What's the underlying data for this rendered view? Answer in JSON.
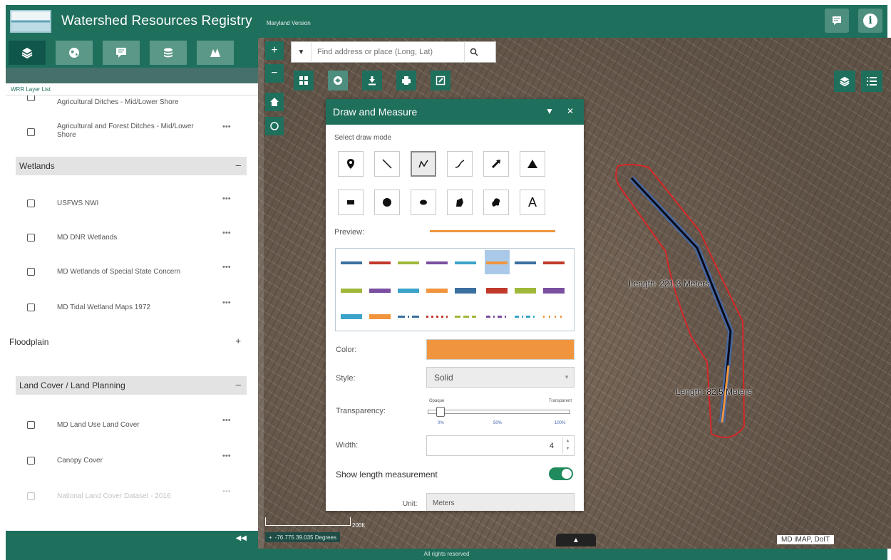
{
  "header": {
    "title": "Watershed Resources Registry",
    "subtitle": "Maryland Version",
    "icons": [
      "message-icon",
      "info-icon"
    ]
  },
  "left_panel": {
    "toolbar_icons": [
      "layers-icon",
      "globe-icon",
      "chat-icon",
      "stack-icon",
      "map-icon"
    ],
    "tab_label": "WRR Layer List",
    "items": [
      {
        "type": "layer",
        "label": "Agricultural Ditches - Mid/Lower Shore"
      },
      {
        "type": "layer",
        "label": "Agricultural and Forest Ditches - Mid/Lower Shore"
      },
      {
        "type": "group",
        "label": "Wetlands",
        "toggle": "–"
      },
      {
        "type": "layer",
        "label": "USFWS NWI"
      },
      {
        "type": "layer",
        "label": "MD DNR Wetlands"
      },
      {
        "type": "layer",
        "label": "MD Wetlands of Special State Concern"
      },
      {
        "type": "layer",
        "label": "MD Tidal Wetland Maps 1972"
      },
      {
        "type": "group",
        "label": "Floodplain",
        "toggle": "+"
      },
      {
        "type": "group",
        "label": "Land Cover / Land Planning",
        "toggle": "–"
      },
      {
        "type": "layer",
        "label": "MD Land Use Land Cover"
      },
      {
        "type": "layer",
        "label": "Canopy Cover"
      },
      {
        "type": "layer",
        "label": "National Land Cover Dataset - 2016"
      }
    ],
    "more_glyph": "•••",
    "collapse_glyph": "◀◀"
  },
  "map": {
    "search_placeholder": "Find address or place (Long, Lat)",
    "zoom_in": "+",
    "zoom_out": "−",
    "scale_label": "200ft",
    "coordinates": "-76.775 39.035 Degrees",
    "attribution": "MD iMAP, DoIT",
    "measurements": [
      "Length: 221.3 Meters",
      "Length: 82.5 Meters"
    ],
    "drawn_line_color": "#f0953e",
    "buffer_color": "#d62728"
  },
  "draw_panel": {
    "title": "Draw and Measure",
    "select_mode_label": "Select draw mode",
    "modes_row1": [
      "point-icon",
      "line-icon",
      "polyline-icon",
      "freehand-line-icon",
      "arrow-icon",
      "triangle-icon"
    ],
    "modes_row2": [
      "rectangle-icon",
      "circle-icon",
      "ellipse-icon",
      "polygon-icon",
      "freehand-polygon-icon",
      "text-icon"
    ],
    "text_mode_glyph": "A",
    "preview_label": "Preview:",
    "color_label": "Color:",
    "color_value": "#f0953e",
    "style_label": "Style:",
    "style_value": "Solid",
    "transparency_label": "Transparency:",
    "transparency_left": "Opaque",
    "transparency_right": "Transparent",
    "transparency_ticks": [
      "0%",
      "50%",
      "100%"
    ],
    "transparency_value": 0.0,
    "width_label": "Width:",
    "width_value": "4",
    "show_length_label": "Show length measurement",
    "show_length_enabled": true,
    "unit_label": "Unit:",
    "unit_value": "Meters"
  },
  "footer": {
    "text": "All rights reserved"
  }
}
